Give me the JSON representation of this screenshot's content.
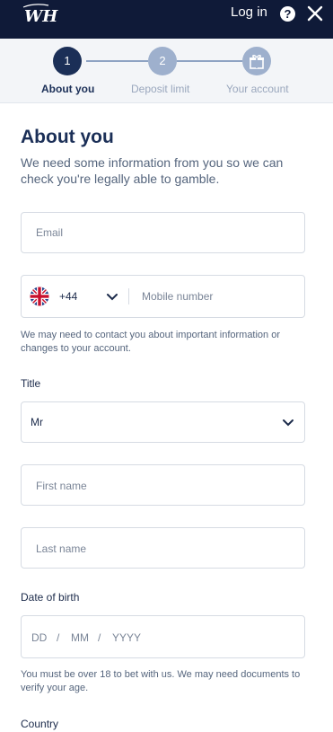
{
  "header": {
    "login_label": "Log in",
    "help_glyph": "?",
    "logo_icon": "william-hill-logo"
  },
  "stepper": {
    "steps": [
      {
        "number": "1",
        "label": "About you",
        "active": true
      },
      {
        "number": "2",
        "label": "Deposit limit",
        "active": false
      },
      {
        "number": "",
        "label": "Your account",
        "active": false,
        "icon": "gift-icon"
      }
    ]
  },
  "form": {
    "heading": "About you",
    "intro": "We need some information from you so we can check you're legally able to gamble.",
    "email_placeholder": "Email",
    "phone": {
      "country_code": "+44",
      "placeholder": "Mobile number",
      "helper": "We may need to contact you about important information or changes to your account."
    },
    "title": {
      "label": "Title",
      "selected": "Mr"
    },
    "first_name_placeholder": "First name",
    "last_name_placeholder": "Last name",
    "dob": {
      "label": "Date of birth",
      "day_placeholder": "DD",
      "month_placeholder": "MM",
      "year_placeholder": "YYYY",
      "separator": "/",
      "helper": "You must be over 18 to bet with us. We may need documents to verify your age."
    },
    "country_label": "Country"
  },
  "colors": {
    "header_bg": "#0f1a38",
    "active_step": "#1b2f57",
    "inactive_step": "#9eb0cd",
    "inactive_step_text": "#9aa7bd"
  }
}
